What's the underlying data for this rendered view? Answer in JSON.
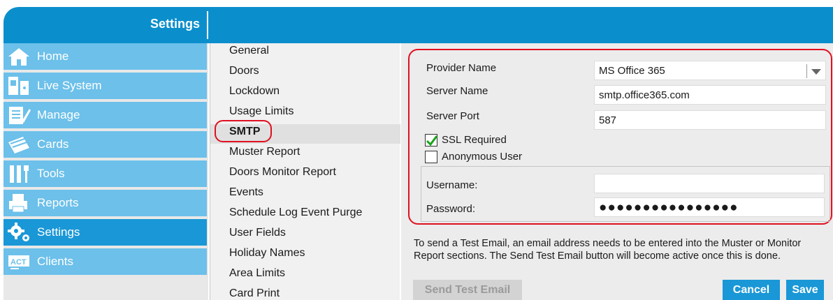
{
  "header": {
    "title": "Settings"
  },
  "sidebar": {
    "items": [
      {
        "label": "Home",
        "icon": "home-icon"
      },
      {
        "label": "Live System",
        "icon": "live-system-icon"
      },
      {
        "label": "Manage",
        "icon": "manage-icon"
      },
      {
        "label": "Cards",
        "icon": "cards-icon"
      },
      {
        "label": "Tools",
        "icon": "tools-icon"
      },
      {
        "label": "Reports",
        "icon": "reports-icon"
      },
      {
        "label": "Settings",
        "icon": "settings-gear-icon",
        "active": true
      },
      {
        "label": "Clients",
        "icon": "clients-icon"
      }
    ]
  },
  "menu": {
    "items": [
      "General",
      "Doors",
      "Lockdown",
      "Usage Limits",
      "SMTP",
      "Muster Report",
      "Doors Monitor Report",
      "Events",
      "Schedule Log Event Purge",
      "User Fields",
      "Holiday Names",
      "Area Limits",
      "Card Print"
    ],
    "selected": "SMTP"
  },
  "smtp": {
    "provider_label": "Provider Name",
    "provider_value": "MS Office 365",
    "server_label": "Server Name",
    "server_value": "smtp.office365.com",
    "port_label": "Server Port",
    "port_value": "587",
    "ssl_label": "SSL Required",
    "ssl_checked": true,
    "anon_label": "Anonymous User",
    "anon_checked": false,
    "username_label": "Username:",
    "username_value": "",
    "required_marker": "*",
    "password_label": "Password:",
    "password_mask": "●●●●●●●●●●●●●●●●"
  },
  "info": "To send a Test Email, an email address needs to be entered into the Muster or Monitor Report sections. The Send Test Email button will become active once this is done.",
  "buttons": {
    "test": "Send Test Email",
    "cancel": "Cancel",
    "save": "Save"
  },
  "colors": {
    "header": "#0b8fcc",
    "nav": "#6cc0ea",
    "nav_active": "#1a97d6",
    "highlight_ring": "#e01020"
  }
}
